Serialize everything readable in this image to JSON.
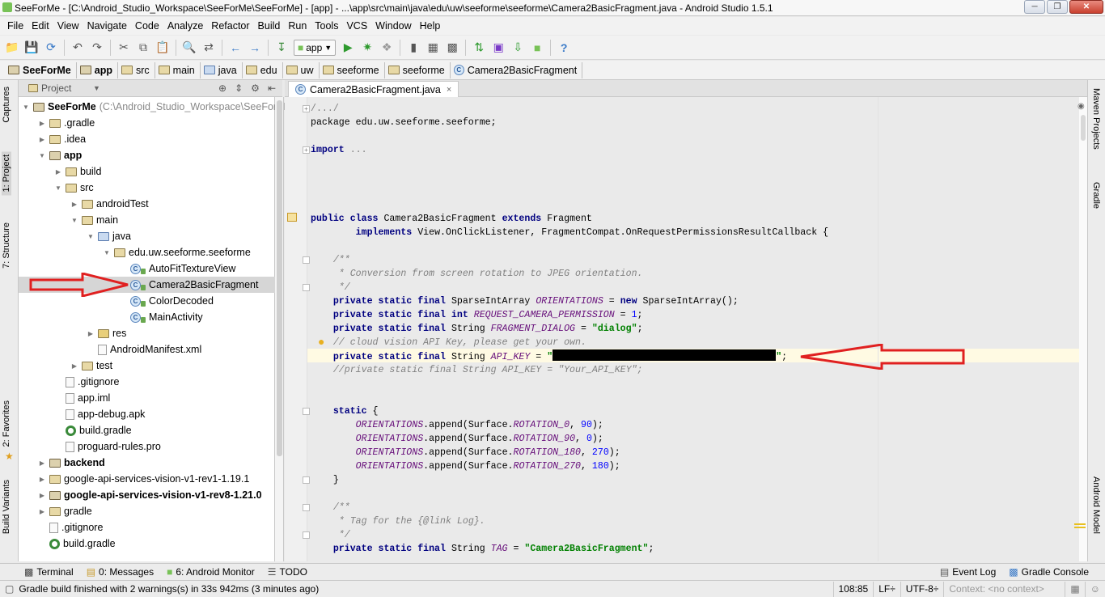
{
  "window": {
    "title": "SeeForMe - [C:\\Android_Studio_Workspace\\SeeForMe\\SeeForMe] - [app] - ...\\app\\src\\main\\java\\edu\\uw\\seeforme\\seeforme\\Camera2BasicFragment.java - Android Studio 1.5.1"
  },
  "menu": [
    "File",
    "Edit",
    "View",
    "Navigate",
    "Code",
    "Analyze",
    "Refactor",
    "Build",
    "Run",
    "Tools",
    "VCS",
    "Window",
    "Help"
  ],
  "toolbar": {
    "run_config": "app"
  },
  "breadcrumbs": [
    "SeeForMe",
    "app",
    "src",
    "main",
    "java",
    "edu",
    "uw",
    "seeforme",
    "seeforme",
    "Camera2BasicFragment"
  ],
  "left_stripe": {
    "captures": "Captures",
    "project": "1: Project",
    "structure": "7: Structure",
    "favorites": "2: Favorites",
    "build_variants": "Build Variants"
  },
  "right_stripe": {
    "maven": "Maven Projects",
    "gradle": "Gradle",
    "android_model": "Android Model"
  },
  "project_panel": {
    "view_label": "Project",
    "tree": [
      {
        "label": "SeeForMe",
        "extra": "(C:\\Android_Studio_Workspace\\SeeForM",
        "bold": true,
        "indent": 0,
        "arrow": "down",
        "icon": "module"
      },
      {
        "label": ".gradle",
        "indent": 1,
        "arrow": "right",
        "icon": "folder"
      },
      {
        "label": ".idea",
        "indent": 1,
        "arrow": "right",
        "icon": "folder"
      },
      {
        "label": "app",
        "bold": true,
        "indent": 1,
        "arrow": "down",
        "icon": "module"
      },
      {
        "label": "build",
        "indent": 2,
        "arrow": "right",
        "icon": "folder"
      },
      {
        "label": "src",
        "indent": 2,
        "arrow": "down",
        "icon": "folder"
      },
      {
        "label": "androidTest",
        "indent": 3,
        "arrow": "right",
        "icon": "folder"
      },
      {
        "label": "main",
        "indent": 3,
        "arrow": "down",
        "icon": "folder"
      },
      {
        "label": "java",
        "indent": 4,
        "arrow": "down",
        "icon": "src"
      },
      {
        "label": "edu.uw.seeforme.seeforme",
        "indent": 5,
        "arrow": "down",
        "icon": "folder"
      },
      {
        "label": "AutoFitTextureView",
        "indent": 6,
        "arrow": "",
        "icon": "class"
      },
      {
        "label": "Camera2BasicFragment",
        "indent": 6,
        "arrow": "",
        "icon": "class",
        "selected": true
      },
      {
        "label": "ColorDecoded",
        "indent": 6,
        "arrow": "",
        "icon": "class"
      },
      {
        "label": "MainActivity",
        "indent": 6,
        "arrow": "",
        "icon": "class"
      },
      {
        "label": "res",
        "indent": 4,
        "arrow": "right",
        "icon": "res"
      },
      {
        "label": "AndroidManifest.xml",
        "indent": 4,
        "arrow": "",
        "icon": "file"
      },
      {
        "label": "test",
        "indent": 3,
        "arrow": "right",
        "icon": "folder"
      },
      {
        "label": ".gitignore",
        "indent": 2,
        "arrow": "",
        "icon": "file"
      },
      {
        "label": "app.iml",
        "indent": 2,
        "arrow": "",
        "icon": "file"
      },
      {
        "label": "app-debug.apk",
        "indent": 2,
        "arrow": "",
        "icon": "file"
      },
      {
        "label": "build.gradle",
        "indent": 2,
        "arrow": "",
        "icon": "gradle"
      },
      {
        "label": "proguard-rules.pro",
        "indent": 2,
        "arrow": "",
        "icon": "file"
      },
      {
        "label": "backend",
        "bold": true,
        "indent": 1,
        "arrow": "right",
        "icon": "module"
      },
      {
        "label": "google-api-services-vision-v1-rev1-1.19.1",
        "indent": 1,
        "arrow": "right",
        "icon": "folder"
      },
      {
        "label": "google-api-services-vision-v1-rev8-1.21.0",
        "bold": true,
        "indent": 1,
        "arrow": "right",
        "icon": "module"
      },
      {
        "label": "gradle",
        "indent": 1,
        "arrow": "right",
        "icon": "folder"
      },
      {
        "label": ".gitignore",
        "indent": 1,
        "arrow": "",
        "icon": "file"
      },
      {
        "label": "build.gradle",
        "indent": 1,
        "arrow": "",
        "icon": "gradle"
      }
    ]
  },
  "editor": {
    "tab_label": "Camera2BasicFragment.java",
    "lines": [
      {
        "segs": [
          {
            "t": "/.../",
            "c": "fold"
          }
        ]
      },
      {
        "segs": [
          {
            "t": "package edu.uw.seeforme.seeforme;",
            "c": ""
          }
        ]
      },
      {
        "segs": []
      },
      {
        "segs": [
          {
            "t": "import",
            "c": "kw"
          },
          {
            "t": " ...",
            "c": "fold"
          }
        ]
      },
      {
        "segs": []
      },
      {
        "segs": []
      },
      {
        "segs": []
      },
      {
        "segs": []
      },
      {
        "segs": [
          {
            "t": "public class ",
            "c": "kw"
          },
          {
            "t": "Camera2BasicFragment ",
            "c": ""
          },
          {
            "t": "extends ",
            "c": "kw"
          },
          {
            "t": "Fragment",
            "c": ""
          }
        ]
      },
      {
        "segs": [
          {
            "t": "        implements ",
            "c": "kw"
          },
          {
            "t": "View.OnClickListener, FragmentCompat.OnRequestPermissionsResultCallback {",
            "c": ""
          }
        ]
      },
      {
        "segs": []
      },
      {
        "segs": [
          {
            "t": "    /**",
            "c": "cm"
          }
        ]
      },
      {
        "segs": [
          {
            "t": "     * Conversion from screen rotation to JPEG orientation.",
            "c": "cm"
          }
        ]
      },
      {
        "segs": [
          {
            "t": "     */",
            "c": "cm"
          }
        ]
      },
      {
        "segs": [
          {
            "t": "    private static final ",
            "c": "kw"
          },
          {
            "t": "SparseIntArray ",
            "c": ""
          },
          {
            "t": "ORIENTATIONS",
            "c": "fld"
          },
          {
            "t": " = ",
            "c": ""
          },
          {
            "t": "new ",
            "c": "kw"
          },
          {
            "t": "SparseIntArray();",
            "c": ""
          }
        ]
      },
      {
        "segs": [
          {
            "t": "    private static final int ",
            "c": "kw"
          },
          {
            "t": "REQUEST_CAMERA_PERMISSION",
            "c": "fld"
          },
          {
            "t": " = ",
            "c": ""
          },
          {
            "t": "1",
            "c": "num"
          },
          {
            "t": ";",
            "c": ""
          }
        ]
      },
      {
        "segs": [
          {
            "t": "    private static final ",
            "c": "kw"
          },
          {
            "t": "String ",
            "c": ""
          },
          {
            "t": "FRAGMENT_DIALOG",
            "c": "fld"
          },
          {
            "t": " = ",
            "c": ""
          },
          {
            "t": "\"dialog\"",
            "c": "str"
          },
          {
            "t": ";",
            "c": ""
          }
        ]
      },
      {
        "segs": [
          {
            "t": "    // cloud vision API Key, please get your own.",
            "c": "cm"
          }
        ]
      },
      {
        "segs": [
          {
            "t": "    private static final ",
            "c": "kw"
          },
          {
            "t": "String ",
            "c": ""
          },
          {
            "t": "API_KEY",
            "c": "fld"
          },
          {
            "t": " = ",
            "c": ""
          },
          {
            "t": "\"",
            "c": "str"
          },
          {
            "t": "",
            "c": "redact"
          },
          {
            "t": "\"",
            "c": "str"
          },
          {
            "t": ";",
            "c": ""
          }
        ]
      },
      {
        "segs": [
          {
            "t": "    //private static final String API_KEY = \"Your_API_KEY\";",
            "c": "cm"
          }
        ]
      },
      {
        "segs": []
      },
      {
        "segs": []
      },
      {
        "segs": [
          {
            "t": "    static ",
            "c": "kw"
          },
          {
            "t": "{",
            "c": ""
          }
        ]
      },
      {
        "segs": [
          {
            "t": "        ",
            "c": ""
          },
          {
            "t": "ORIENTATIONS",
            "c": "fld"
          },
          {
            "t": ".append(Surface.",
            "c": ""
          },
          {
            "t": "ROTATION_0",
            "c": "fld"
          },
          {
            "t": ", ",
            "c": ""
          },
          {
            "t": "90",
            "c": "num"
          },
          {
            "t": ");",
            "c": ""
          }
        ]
      },
      {
        "segs": [
          {
            "t": "        ",
            "c": ""
          },
          {
            "t": "ORIENTATIONS",
            "c": "fld"
          },
          {
            "t": ".append(Surface.",
            "c": ""
          },
          {
            "t": "ROTATION_90",
            "c": "fld"
          },
          {
            "t": ", ",
            "c": ""
          },
          {
            "t": "0",
            "c": "num"
          },
          {
            "t": ");",
            "c": ""
          }
        ]
      },
      {
        "segs": [
          {
            "t": "        ",
            "c": ""
          },
          {
            "t": "ORIENTATIONS",
            "c": "fld"
          },
          {
            "t": ".append(Surface.",
            "c": ""
          },
          {
            "t": "ROTATION_180",
            "c": "fld"
          },
          {
            "t": ", ",
            "c": ""
          },
          {
            "t": "270",
            "c": "num"
          },
          {
            "t": ");",
            "c": ""
          }
        ]
      },
      {
        "segs": [
          {
            "t": "        ",
            "c": ""
          },
          {
            "t": "ORIENTATIONS",
            "c": "fld"
          },
          {
            "t": ".append(Surface.",
            "c": ""
          },
          {
            "t": "ROTATION_270",
            "c": "fld"
          },
          {
            "t": ", ",
            "c": ""
          },
          {
            "t": "180",
            "c": "num"
          },
          {
            "t": ");",
            "c": ""
          }
        ]
      },
      {
        "segs": [
          {
            "t": "    }",
            "c": ""
          }
        ]
      },
      {
        "segs": []
      },
      {
        "segs": [
          {
            "t": "    /**",
            "c": "cm"
          }
        ]
      },
      {
        "segs": [
          {
            "t": "     * Tag for the {",
            "c": "cm"
          },
          {
            "t": "@link",
            "c": "cm"
          },
          {
            "t": " Log}.",
            "c": "cm"
          }
        ]
      },
      {
        "segs": [
          {
            "t": "     */",
            "c": "cm"
          }
        ]
      },
      {
        "segs": [
          {
            "t": "    private static final ",
            "c": "kw"
          },
          {
            "t": "String ",
            "c": ""
          },
          {
            "t": "TAG",
            "c": "fld"
          },
          {
            "t": " = ",
            "c": ""
          },
          {
            "t": "\"Camera2BasicFragment\"",
            "c": "str"
          },
          {
            "t": ";",
            "c": ""
          }
        ]
      }
    ]
  },
  "bottom_tabs": {
    "terminal": "Terminal",
    "messages": "0: Messages",
    "android_monitor": "6: Android Monitor",
    "todo": "TODO",
    "event_log": "Event Log",
    "gradle_console": "Gradle Console"
  },
  "status": {
    "message": "Gradle build finished with 2 warnings(s) in 33s 942ms (3 minutes ago)",
    "position": "108:85",
    "line_sep": "LF÷",
    "encoding": "UTF-8÷",
    "context": "Context: <no context>"
  },
  "colors": {
    "arrow": "#e02020",
    "keyword": "#000080",
    "field": "#660e7a",
    "string": "#008000",
    "comment": "#808080"
  }
}
